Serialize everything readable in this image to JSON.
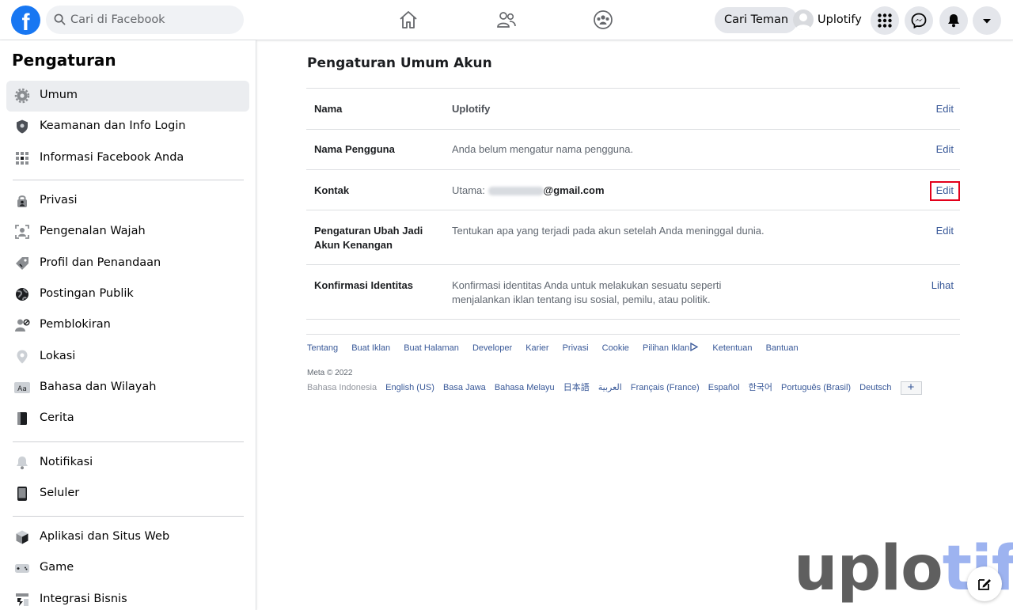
{
  "header": {
    "search_placeholder": "Cari di Facebook",
    "find_friends": "Cari Teman",
    "profile_name": "Uplotify"
  },
  "sidebar": {
    "title": "Pengaturan",
    "items": [
      {
        "label": "Umum",
        "icon": "gear-icon",
        "active": true
      },
      {
        "label": "Keamanan dan Info Login",
        "icon": "shield-icon"
      },
      {
        "label": "Informasi Facebook Anda",
        "icon": "grid-icon"
      },
      {
        "label": "Privasi",
        "icon": "lock-person-icon"
      },
      {
        "label": "Pengenalan Wajah",
        "icon": "face-scan-icon"
      },
      {
        "label": "Profil dan Penandaan",
        "icon": "tag-icon"
      },
      {
        "label": "Postingan Publik",
        "icon": "globe-icon"
      },
      {
        "label": "Pemblokiran",
        "icon": "block-user-icon"
      },
      {
        "label": "Lokasi",
        "icon": "location-pin-icon"
      },
      {
        "label": "Bahasa dan Wilayah",
        "icon": "language-icon"
      },
      {
        "label": "Cerita",
        "icon": "book-icon"
      },
      {
        "label": "Notifikasi",
        "icon": "bell-icon"
      },
      {
        "label": "Seluler",
        "icon": "mobile-icon"
      },
      {
        "label": "Aplikasi dan Situs Web",
        "icon": "cube-icon"
      },
      {
        "label": "Game",
        "icon": "gamepad-icon"
      },
      {
        "label": "Integrasi Bisnis",
        "icon": "business-icon"
      }
    ]
  },
  "main": {
    "title": "Pengaturan Umum Akun",
    "rows": [
      {
        "key": "Nama",
        "value": "Uplotify",
        "action": "Edit"
      },
      {
        "key": "Nama Pengguna",
        "value": "Anda belum mengatur nama pengguna.",
        "action": "Edit"
      },
      {
        "key": "Kontak",
        "value_prefix": "Utama:",
        "value_email_suffix": "@gmail.com",
        "action": "Edit"
      },
      {
        "key_line1": "Pengaturan Ubah Jadi",
        "key_line2": "Akun Kenangan",
        "value": "Tentukan apa yang terjadi pada akun setelah Anda meninggal dunia.",
        "action": "Edit"
      },
      {
        "key": "Konfirmasi Identitas",
        "value_line1": "Konfirmasi identitas Anda untuk melakukan sesuatu seperti",
        "value_line2": "menjalankan iklan tentang isu sosial, pemilu, atau politik.",
        "action": "Lihat"
      }
    ]
  },
  "footer": {
    "links": [
      "Tentang",
      "Buat Iklan",
      "Buat Halaman",
      "Developer",
      "Karier",
      "Privasi",
      "Cookie",
      "Pilihan Iklan",
      "Ketentuan",
      "Bantuan"
    ],
    "copyright": "Meta © 2022",
    "current_language": "Bahasa Indonesia",
    "languages": [
      "English (US)",
      "Basa Jawa",
      "Bahasa Melayu",
      "日本語",
      "العربية",
      "Français (France)",
      "Español",
      "한국어",
      "Português (Brasil)",
      "Deutsch"
    ],
    "more": "+"
  },
  "watermark": {
    "part1": "uplo",
    "part2": "tify"
  },
  "colors": {
    "fb_blue": "#1877f2",
    "link": "#385898",
    "highlight": "#e3001b"
  }
}
